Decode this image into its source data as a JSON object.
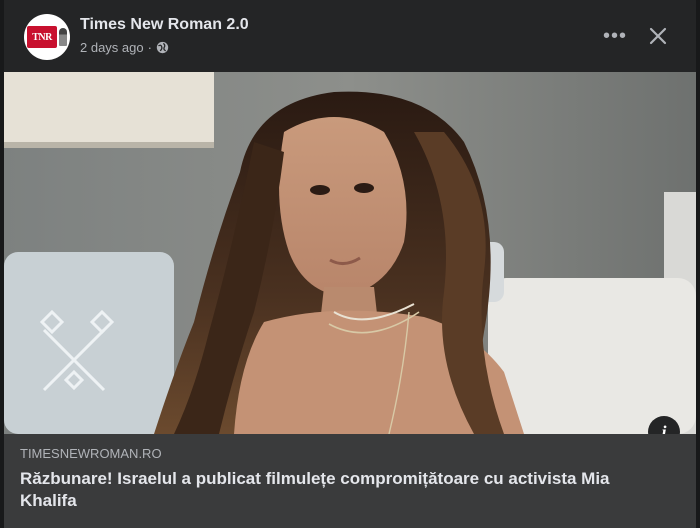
{
  "post": {
    "page_name": "Times New Roman 2.0",
    "timestamp": "2 days ago",
    "separator": "·",
    "privacy_icon": "globe-icon",
    "avatar_logo_text": "TNR",
    "more_icon_text": "•••"
  },
  "link_preview": {
    "domain": "TIMESNEWROMAN.RO",
    "headline": "Răzbunare! Israelul a publicat filmulețe compromițătoare cu activista Mia Khalifa",
    "info_icon_text": "i"
  },
  "colors": {
    "background": "#18191a",
    "card": "#242526",
    "link_box": "#3a3b3c",
    "primary_text": "#e4e6eb",
    "secondary_text": "#b0b3b8",
    "brand_red": "#c8102e"
  }
}
